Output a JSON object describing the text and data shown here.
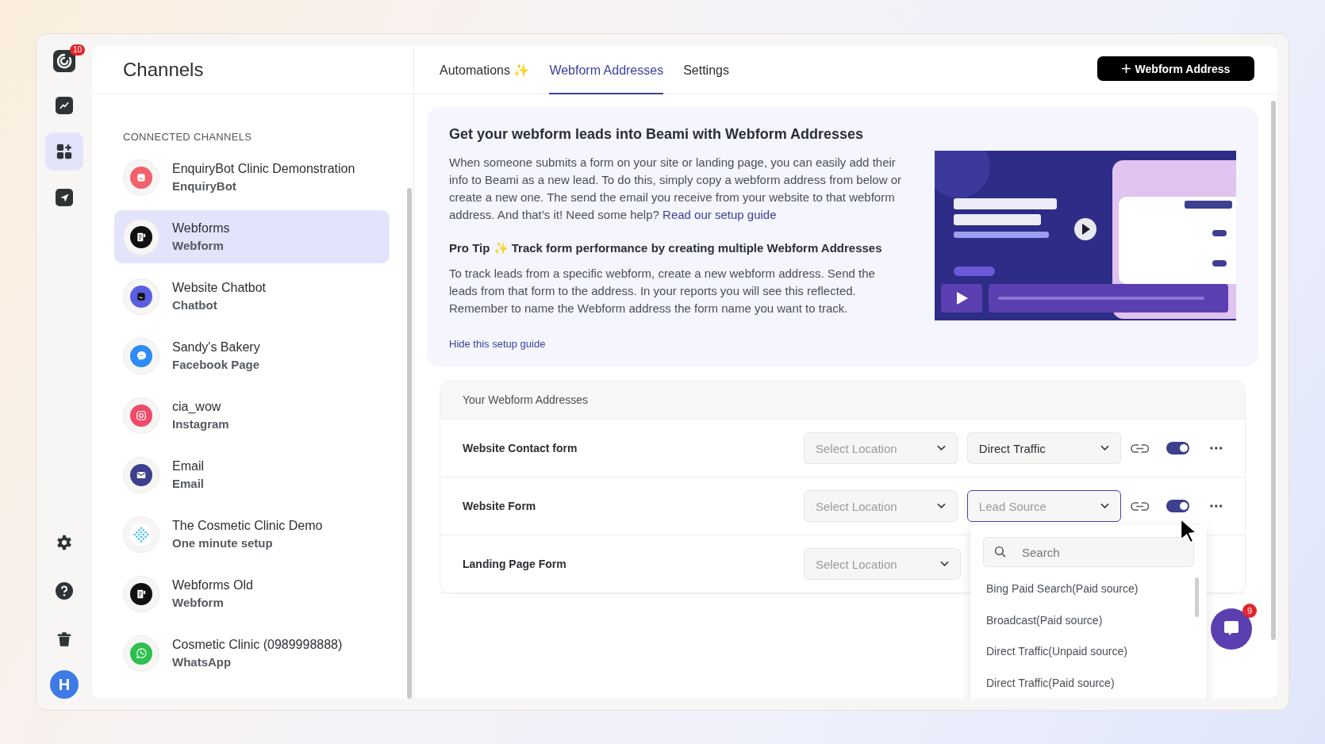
{
  "rail": {
    "logo_badge": "10",
    "items": [
      {
        "selected": false
      },
      {
        "selected": true
      },
      {
        "selected": false
      }
    ],
    "avatar": "H"
  },
  "sidebar": {
    "title": "Channels",
    "section_label": "CONNECTED CHANNELS",
    "channels": [
      {
        "name": "EnquiryBot Clinic Demonstration",
        "type": "EnquiryBot",
        "kind": "enquirybot",
        "selected": false
      },
      {
        "name": "Webforms",
        "type": "Webform",
        "kind": "webform",
        "selected": true
      },
      {
        "name": "Website Chatbot",
        "type": "Chatbot",
        "kind": "chatbot",
        "selected": false
      },
      {
        "name": "Sandy's Bakery",
        "type": "Facebook Page",
        "kind": "messenger",
        "selected": false
      },
      {
        "name": "cia_wow",
        "type": "Instagram",
        "kind": "instagram",
        "selected": false
      },
      {
        "name": "Email",
        "type": "Email",
        "kind": "email",
        "selected": false
      },
      {
        "name": "The Cosmetic Clinic Demo",
        "type": "One minute setup",
        "kind": "cosmetic",
        "selected": false
      },
      {
        "name": "Webforms Old",
        "type": "Webform",
        "kind": "webform",
        "selected": false
      },
      {
        "name": "Cosmetic Clinic (0989998888)",
        "type": "WhatsApp",
        "kind": "whatsapp",
        "selected": false
      }
    ]
  },
  "tabs": [
    {
      "label": "Automations ✨",
      "selected": false
    },
    {
      "label": "Webform Addresses",
      "selected": true
    },
    {
      "label": "Settings",
      "selected": false
    }
  ],
  "add_button": "Webform Address",
  "guide": {
    "title": "Get your webform leads into Beami with Webform Addresses",
    "intro": "When someone submits a form on your site or landing page, you can easily add their info to Beami as a new lead. To do this, simply copy a webform address from below or create a new one. The send the email you receive from your website to that webform address. And that’s it! Need some help?",
    "intro_link": "Read our setup guide",
    "tip_title": "Pro Tip ✨ Track form performance by creating multiple Webform Addresses",
    "tip_text": "To track leads from a specific webform, create a new webform address. Send the leads from that form to the address. In your reports you will see this reflected. Remember to name the Webform address the form name you want to track.",
    "hide_link": "Hide this setup guide"
  },
  "addresses": {
    "heading": "Your Webform Addresses",
    "rows": [
      {
        "name": "Website Contact form",
        "location_placeholder": "Select Location",
        "source": {
          "value": "Direct Traffic",
          "open": false
        },
        "enabled": true
      },
      {
        "name": "Website Form",
        "location_placeholder": "Select Location",
        "source": {
          "placeholder": "Lead Source",
          "open": true
        },
        "enabled": true
      },
      {
        "name": "Landing Page Form",
        "location_placeholder": "Select Location"
      }
    ]
  },
  "source_menu": {
    "search_placeholder": "Search",
    "options": [
      "Bing Paid Search(Paid source)",
      "Broadcast(Paid source)",
      "Direct Traffic(Unpaid source)",
      "Direct Traffic(Paid source)"
    ]
  },
  "chat_badge": "9"
}
